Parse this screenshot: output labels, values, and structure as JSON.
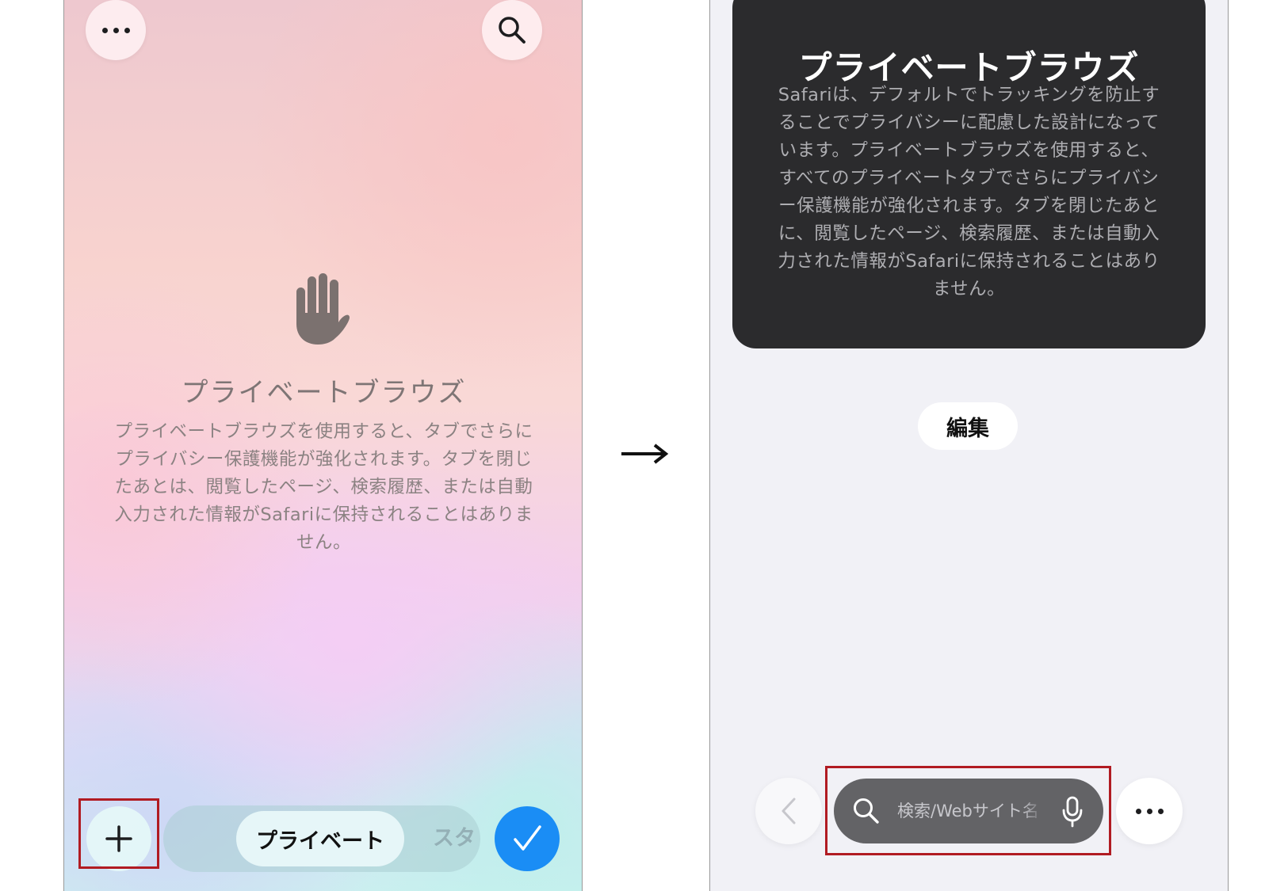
{
  "left_screen": {
    "title": "プライベートブラウズ",
    "body": "プライベートブラウズを使用すると、タブでさらにプライバシー保護機能が強化されます。タブを閉じたあとは、閲覧したページ、検索履歴、または自動入力された情報がSafariに保持されることはありません。",
    "hand_icon": "raised-hand-icon",
    "top_left_icon": "more-icon",
    "top_right_icon": "search-icon",
    "tab_groups": {
      "active": "プライベート",
      "next": "スタート"
    },
    "new_tab_icon": "plus-icon",
    "done_icon": "checkmark-icon",
    "accent_color": "#1a8df5"
  },
  "right_screen": {
    "title": "プライベートブラウズ",
    "body": "Safariは、デフォルトでトラッキングを防止することでプライバシーに配慮した設計になっています。プライベートブラウズを使用すると、すべてのプライベートタブでさらにプライバシー保護機能が強化されます。タブを閉じたあとに、閲覧したページ、検索履歴、または自動入力された情報がSafariに保持されることはありません。",
    "edit_label": "編集",
    "search_placeholder": "検索/Webサイト名",
    "back_icon": "chevron-left-icon",
    "mic_icon": "microphone-icon",
    "more_icon": "more-icon",
    "card_color": "#2b2b2d"
  },
  "highlight_color": "#b11b22"
}
